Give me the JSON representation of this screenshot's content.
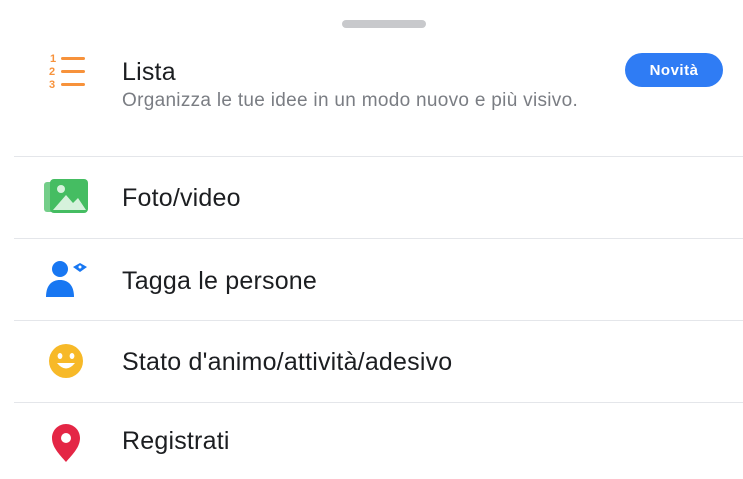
{
  "sheet": {
    "items": [
      {
        "label": "Lista",
        "description": "Organizza le tue idee in un modo nuovo e più visivo.",
        "badge": "Novità",
        "icon": "numbered-list-icon",
        "icon_color": "#f7923b"
      },
      {
        "label": "Foto/video",
        "icon": "photo-video-icon",
        "icon_color": "#45bd62"
      },
      {
        "label": "Tagga le persone",
        "icon": "tag-people-icon",
        "icon_color": "#1877f2"
      },
      {
        "label": "Stato d'animo/attività/adesivo",
        "icon": "smiley-icon",
        "icon_color": "#f7b928"
      },
      {
        "label": "Registrati",
        "icon": "location-pin-icon",
        "icon_color": "#e42645"
      }
    ]
  },
  "colors": {
    "badge": "#2f7cf4",
    "divider": "#e4e6ea",
    "text": "#1c1e21",
    "secondary_text": "#7a7d83"
  }
}
